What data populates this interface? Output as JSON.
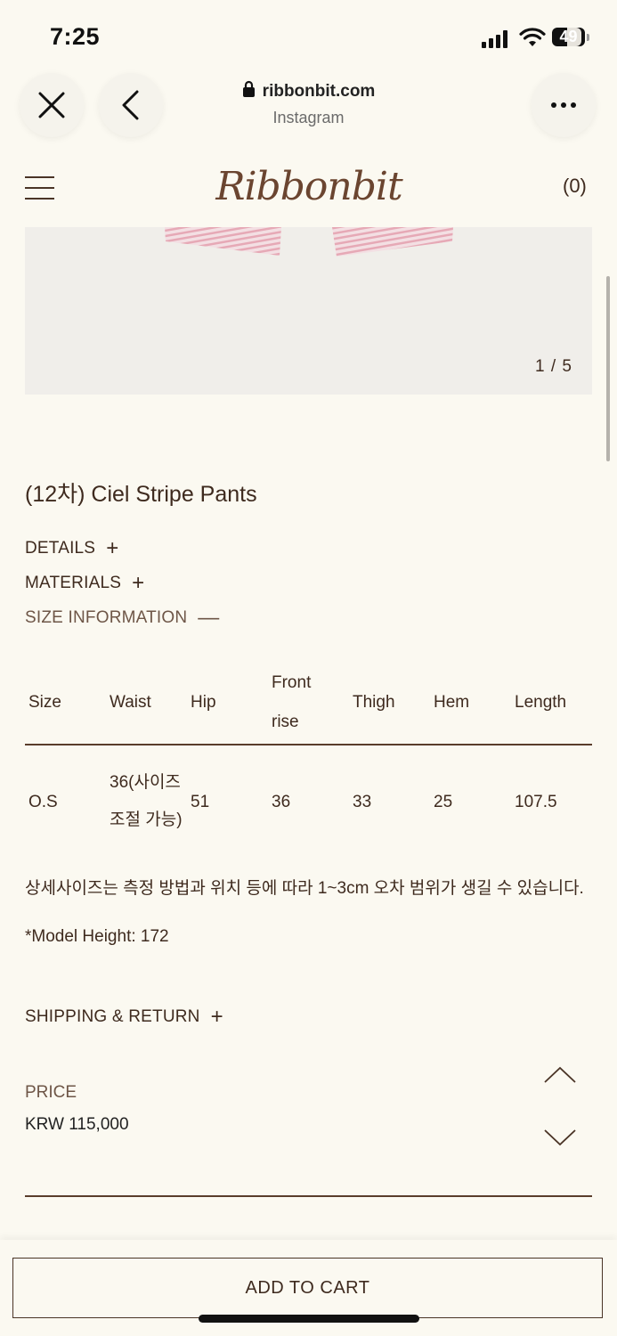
{
  "status_bar": {
    "time": "7:25",
    "battery": "49"
  },
  "browser": {
    "domain": "ribbonbit.com",
    "source": "Instagram"
  },
  "site": {
    "logo": "Ribbonbit",
    "cart_count": "(0)"
  },
  "gallery": {
    "counter": "1 / 5"
  },
  "product": {
    "title": "(12차) Ciel Stripe Pants",
    "sections": {
      "details": "DETAILS",
      "materials": "MATERIALS",
      "size_information": "SIZE INFORMATION",
      "shipping": "SHIPPING & RETURN"
    },
    "size_table": {
      "headers": [
        "Size",
        "Waist",
        "Hip",
        "Front",
        "rise",
        "Thigh",
        "Hem",
        "Length"
      ],
      "row": [
        "O.S",
        "36(사이즈",
        "조절 가능)",
        "51",
        "36",
        "33",
        "25",
        "107.5"
      ]
    },
    "size_note": "상세사이즈는 측정 방법과 위치 등에 따라 1~3cm 오차 범위가 생길 수 있습니다.",
    "model_height": "*Model Height: 172",
    "price_label": "PRICE",
    "price": "KRW 115,000"
  },
  "actions": {
    "add_to_cart": "ADD TO CART"
  },
  "colors": {
    "background": "#fbf9f1",
    "text": "#3e2a1e",
    "accent": "#6b4530"
  }
}
